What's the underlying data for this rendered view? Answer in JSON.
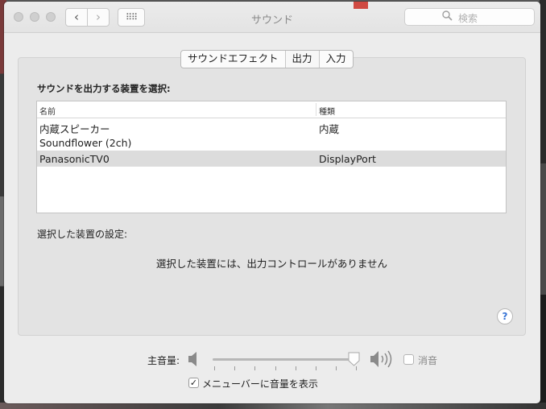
{
  "window": {
    "title": "サウンド",
    "search_placeholder": "検索",
    "nav_back_glyph": "‹",
    "nav_forward_glyph": "›",
    "grid_glyph": "⠿⠿"
  },
  "tabs": [
    {
      "label": "サウンドエフェクト",
      "selected": false
    },
    {
      "label": "出力",
      "selected": true
    },
    {
      "label": "入力",
      "selected": false
    }
  ],
  "output": {
    "select_label": "サウンドを出力する装置を選択:",
    "columns": {
      "name": "名前",
      "type": "種類"
    },
    "devices": [
      {
        "name": "内蔵スピーカー",
        "type": "内蔵",
        "selected": false
      },
      {
        "name": "Soundflower (2ch)",
        "type": "",
        "selected": false
      },
      {
        "name": "PanasonicTV0",
        "type": "DisplayPort",
        "selected": true
      }
    ],
    "settings_label": "選択した装置の設定:",
    "no_controls_message": "選択した装置には、出力コントロールがありません",
    "help_glyph": "?"
  },
  "volume": {
    "label": "主音量:",
    "level_percent": 97,
    "mute_label": "消音",
    "mute_checked": false,
    "show_in_menubar_label": "メニューバーに音量を表示",
    "show_in_menubar_checked": true,
    "check_glyph": "✓"
  },
  "icons": {
    "close": "close-icon",
    "minimize": "minimize-icon",
    "zoom": "zoom-icon",
    "search": "search-icon",
    "speaker_low": "speaker-low-icon",
    "speaker_high": "speaker-high-icon",
    "help": "help-icon"
  },
  "colors": {
    "window_bg": "#ececec",
    "selection_row": "#dcdcdc",
    "help_accent": "#3a76d6"
  }
}
